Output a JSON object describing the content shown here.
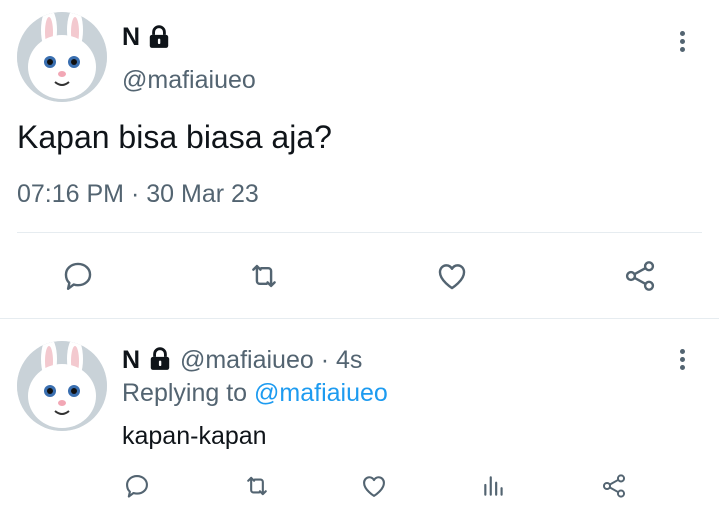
{
  "tweet": {
    "author_name": "N",
    "author_handle": "@mafiaiueo",
    "text": "Kapan bisa biasa aja?",
    "time": "07:16 PM",
    "separator": "·",
    "date": "30 Mar 23"
  },
  "reply": {
    "author_name": "N",
    "author_handle": "@mafiaiueo",
    "separator": "·",
    "age": "4s",
    "replying_prefix": "Replying to",
    "replying_handle": "@mafiaiueo",
    "text": "kapan-kapan"
  },
  "icons": {
    "lock": "lock-icon",
    "more": "more-vertical-icon",
    "reply": "reply-icon",
    "retweet": "retweet-icon",
    "like": "heart-icon",
    "analytics": "analytics-icon",
    "share": "share-icon"
  },
  "colors": {
    "text": "#0f1419",
    "secondary": "#536471",
    "link": "#1d9bf0",
    "divider": "#e6ecf0"
  }
}
